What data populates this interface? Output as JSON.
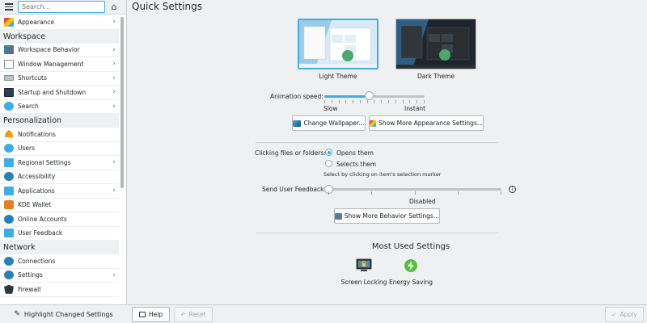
{
  "search": {
    "placeholder": "Search..."
  },
  "sidebar": {
    "items": [
      {
        "label": "Appearance",
        "icon": "appearance-icon",
        "chevron": true
      },
      {
        "section": "Workspace"
      },
      {
        "label": "Workspace Behavior",
        "icon": "workspace-behavior-icon",
        "chevron": true
      },
      {
        "label": "Window Management",
        "icon": "window-management-icon",
        "chevron": true
      },
      {
        "label": "Shortcuts",
        "icon": "keyboard-icon",
        "chevron": true
      },
      {
        "label": "Startup and Shutdown",
        "icon": "startup-icon",
        "chevron": true
      },
      {
        "label": "Search",
        "icon": "search-globe-icon",
        "chevron": true
      },
      {
        "section": "Personalization"
      },
      {
        "label": "Notifications",
        "icon": "bell-icon",
        "chevron": false
      },
      {
        "label": "Users",
        "icon": "users-icon",
        "chevron": false
      },
      {
        "label": "Regional Settings",
        "icon": "flag-icon",
        "chevron": true
      },
      {
        "label": "Accessibility",
        "icon": "accessibility-icon",
        "chevron": false
      },
      {
        "label": "Applications",
        "icon": "applications-icon",
        "chevron": true
      },
      {
        "label": "KDE Wallet",
        "icon": "wallet-icon",
        "chevron": false
      },
      {
        "label": "Online Accounts",
        "icon": "online-accounts-icon",
        "chevron": false
      },
      {
        "label": "User Feedback",
        "icon": "feedback-icon",
        "chevron": false
      },
      {
        "section": "Network"
      },
      {
        "label": "Connections",
        "icon": "connections-icon",
        "chevron": false
      },
      {
        "label": "Settings",
        "icon": "network-settings-icon",
        "chevron": true
      },
      {
        "label": "Firewall",
        "icon": "firewall-icon",
        "chevron": false
      }
    ],
    "highlight_label": "Highlight Changed Settings"
  },
  "main": {
    "title": "Quick Settings",
    "light_theme": "Light Theme",
    "dark_theme": "Dark Theme",
    "animation_speed_label": "Animation speed:",
    "animation_slow": "Slow",
    "animation_instant": "Instant",
    "animation_level": 0.45,
    "change_wallpaper": "Change Wallpaper...",
    "more_appearance": "Show More Appearance Settings...",
    "clicking_label": "Clicking files or folders:",
    "opens_them": "Opens them",
    "selects_them": "Selects them",
    "select_hint": "Select by clicking on item's selection marker",
    "feedback_label": "Send User Feedback:",
    "feedback_value": "Disabled",
    "more_behavior": "Show More Behavior Settings...",
    "most_used_title": "Most Used Settings",
    "most_used": [
      {
        "label": "Screen Locking",
        "icon": "screen-lock-icon"
      },
      {
        "label": "Energy Saving",
        "icon": "energy-saving-icon"
      }
    ]
  },
  "bottom": {
    "help": "Help",
    "reset": "Reset",
    "apply": "Apply"
  },
  "colors": {
    "accent": "#3daee9",
    "background": "#eff0f1"
  }
}
